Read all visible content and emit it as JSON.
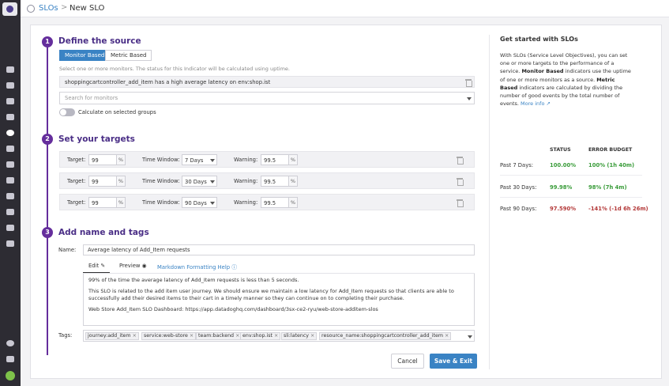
{
  "breadcrumb": {
    "parent": "SLOs",
    "separator": ">",
    "current": "New SLO"
  },
  "steps": [
    {
      "number": "1",
      "title": "Define the source"
    },
    {
      "number": "2",
      "title": "Set your targets"
    },
    {
      "number": "3",
      "title": "Add name and tags"
    }
  ],
  "source": {
    "monitor_based_label": "Monitor Based",
    "metric_based_label": "Metric Based",
    "hint": "Select one or more monitors. The status for this Indicator will be calculated using uptime.",
    "selected_monitor": "shoppingcartcontroller_add_item has a high average latency on env:shop.ist",
    "search_placeholder": "Search for monitors",
    "calc_groups_label": "Calculate on selected groups"
  },
  "targets": {
    "target_label": "Target:",
    "window_label": "Time Window:",
    "warning_label": "Warning:",
    "unit": "%",
    "rows": [
      {
        "target": "99",
        "window": "7 Days",
        "warning": "99.5"
      },
      {
        "target": "99",
        "window": "30 Days",
        "warning": "99.5"
      },
      {
        "target": "99",
        "window": "90 Days",
        "warning": "99.5"
      }
    ]
  },
  "details": {
    "name_label": "Name:",
    "name_value": "Average latency of Add_Item requests",
    "tab_edit": "Edit",
    "tab_preview": "Preview",
    "tab_markdown": "Markdown Formatting Help",
    "description": [
      "99% of the time the average latency of Add_Item requests is less than 5 seconds.",
      "This SLO is related to the add item user journey. We should ensure we maintain a low latency for Add_Item requests so that clients are able to successfully add their desired items to their cart in a timely manner so they can continue on to completing their purchase.",
      "Web Store Add_Item SLO Dashboard: https://app.datadoghq.com/dashboard/3sx-ce2-ryu/web-store-additem-slos"
    ],
    "tags_label": "Tags:",
    "tags": [
      "journey:add_item",
      "service:web-store",
      "team:backend",
      "env:shop.ist",
      "sli:latency",
      "resource_name:shoppingcartcontroller_add_item"
    ],
    "tag_remove": "×"
  },
  "actions": {
    "cancel": "Cancel",
    "save": "Save & Exit"
  },
  "sidebar_help": {
    "title": "Get started with SLOs",
    "intro": "With SLOs (Service Level Objectives), you can set one or more targets to the performance of a service.",
    "monitor_term": "Monitor Based",
    "monitor_text": "indicators use the uptime of one or more monitors as a source.",
    "metric_term": "Metric Based",
    "metric_text": "indicators are calculated by dividing the number of good events by the total number of events.",
    "more_info": "More info",
    "status_header": "STATUS",
    "budget_header": "ERROR BUDGET",
    "rows": [
      {
        "label": "Past 7 Days:",
        "status": "100.00%",
        "budget": "100% (1h 40m)"
      },
      {
        "label": "Past 30 Days:",
        "status": "99.98%",
        "budget": "98% (7h 4m)"
      },
      {
        "label": "Past 90 Days:",
        "status": "97.590%",
        "budget": "-141% (-1d 6h 26m)"
      }
    ]
  },
  "colors": {
    "accent": "#652e9c",
    "link": "#3a83c4",
    "good": "#3a9c3a",
    "bad": "#b33838"
  }
}
